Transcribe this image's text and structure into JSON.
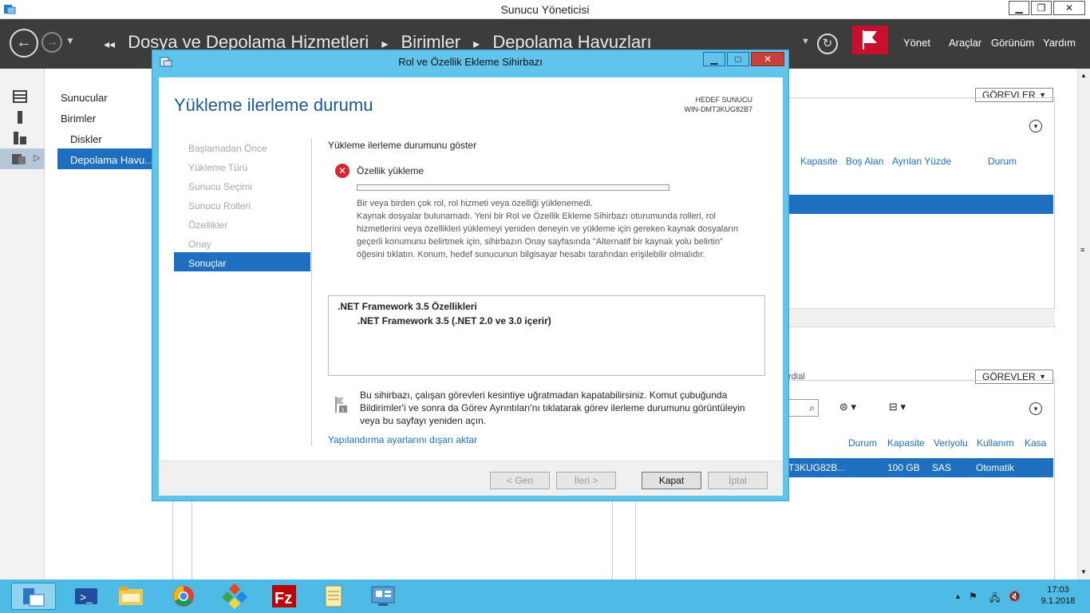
{
  "window": {
    "title": "Sunucu Yöneticisi",
    "minimize_label": "▁",
    "maximize_label": "❐",
    "close_label": "✕"
  },
  "nav": {
    "breadcrumb": [
      "Dosya ve Depolama Hizmetleri",
      "Birimler",
      "Depolama Havuzları"
    ],
    "menus": [
      "Yönet",
      "Araçlar",
      "Görünüm",
      "Yardım"
    ]
  },
  "tree": {
    "items": [
      "Sunucular",
      "Birimler",
      "Diskler",
      "Depolama Havu..."
    ]
  },
  "right": {
    "gorevler": "GÖREVLER",
    "columns_top": [
      "Kapasite",
      "Boş Alan",
      "Ayrılan Yüzde",
      "Durum"
    ],
    "section_label": "rdial",
    "columns_bottom": [
      "Durum",
      "Kapasite",
      "Veriyolu",
      "Kullanım",
      "Kasa"
    ],
    "row_bottom": [
      "T3KUG82B...",
      "100 GB",
      "SAS",
      "Otomatik"
    ]
  },
  "dialog": {
    "title": "Rol ve Özellik Ekleme Sihirbazı",
    "page_title": "Yükleme ilerleme durumu",
    "hedef_label": "HEDEF SUNUCU",
    "hedef_value": "WIN-DMT3KUG82B7",
    "steps": [
      "Başlamadan Önce",
      "Yükleme Türü",
      "Sunucu Seçimi",
      "Sunucu Rolleri",
      "Özellikler",
      "Onay",
      "Sonuçlar"
    ],
    "progress_heading": "Yükleme ilerleme durumunu göster",
    "status_label": "Özellik yükleme",
    "msg1": "Bir veya birden çok rol, rol hizmeti veya özelliği yüklenemedi.",
    "msg2": "Kaynak dosyalar bulunamadı. Yeni bir Rol ve Özellik Ekleme Sihirbazı oturumunda rolleri, rol hizmetlerini veya özellikleri yüklemeyi yeniden deneyin ve yükleme için gereken kaynak dosyaların geçerli konumunu belirtmek için, sihirbazın Onay sayfasında \"Alternatif bir kaynak yolu belirtin\" öğesini tıklatın. Konum, hedef sunucunun bilgisayar hesabı tarafından erişilebilir olmalıdır.",
    "features": [
      ".NET Framework 3.5 Özellikleri",
      ".NET Framework 3.5 (.NET 2.0 ve 3.0 içerir)"
    ],
    "info": "Bu sihirbazı, çalışan görevleri kesintiye uğratmadan kapatabilirsiniz. Komut çubuğunda Bildirimler'i ve sonra da Görev Ayrıntıları'nı tıklatarak görev ilerleme durumunu görüntüleyin veya bu sayfayı yeniden açın.",
    "export_link": "Yapılandırma ayarlarını dışarı aktar",
    "buttons": {
      "back": "< Geri",
      "next": "İleri >",
      "close": "Kapat",
      "cancel": "İptal"
    },
    "progress": 0
  },
  "taskbar": {
    "time": "17:03",
    "date": "9.1.2018"
  }
}
